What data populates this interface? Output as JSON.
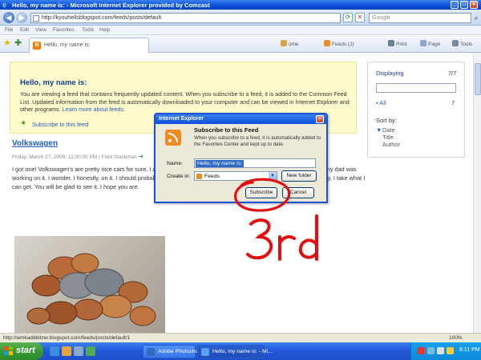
{
  "window": {
    "title": "Hello, my name is: - Microsoft Internet Explorer provided by Comcast",
    "url": "http://kyouhellsblogspot.com/feeds/posts/default"
  },
  "search": {
    "placeholder": "Google"
  },
  "menu": [
    "File",
    "Edit",
    "View",
    "Favorites",
    "Tools",
    "Help"
  ],
  "tab": {
    "label": "Hello, my name is:"
  },
  "commands": {
    "home": "ome",
    "feeds": "Feeds (J)",
    "print": "Print",
    "page": "Page",
    "tools": "Tools"
  },
  "feed": {
    "hello": "Hello, my name is:",
    "info": "You are viewing a feed that contains frequently updated content. When you subscribe to a feed, it is added to the Common Feed List. Updated information from the feed is automatically downloaded to your computer and can be viewed in Internet Explorer and other programs.",
    "learn_more": "Learn more about feeds.",
    "subscribe_link": "Subscribe to this feed"
  },
  "sidebar": {
    "displaying": "Displaying",
    "count": "7/7",
    "all": "All",
    "all_count": "7",
    "sort_by": "Sort by:",
    "sort_options": [
      "Date",
      "Title",
      "Author"
    ]
  },
  "post": {
    "title": "Volkswagen",
    "meta": "Friday, March 27, 2009, 11:00:00 PM | Fred Stackman",
    "body": "I got one! Volkswagen's are pretty nice cars for sure. I am not sure I can think of anything too nice to say about them, but my dad was working on it. I wonder. I honestly, on it. I should probably put it in the garage where I can work on it in a safe place, but hey, I take what I can get. You will be glad to see it. I hope you are."
  },
  "dialog": {
    "title": "Internet Explorer",
    "heading": "Subscribe to this Feed",
    "description": "When you subscribe to a feed, it is automatically added to the Favorites Center and kept up to date.",
    "name_label": "Name:",
    "name_value": "Hello, my name is:",
    "create_in_label": "Create in:",
    "create_in_value": "Feeds",
    "new_folder": "New folder",
    "subscribe": "Subscribe",
    "cancel": "Cancel"
  },
  "annotation": {
    "text": "3rd",
    "color": "#e01010"
  },
  "status": {
    "text": "http://wmkaddbitzer.blogspot.com/feeds/posts/default/1",
    "zoom": "100%"
  },
  "taskbar": {
    "start": "start",
    "items": [
      "Adobe Photoshop",
      "Hello, my name is: - Mi..."
    ],
    "clock": "8:11 PM"
  },
  "colors": {
    "accent": "#1e5dc0",
    "feed_box_bg": "#fffbcc",
    "xp_blue": "#0a4fd8",
    "start_green": "#3a9a36"
  }
}
